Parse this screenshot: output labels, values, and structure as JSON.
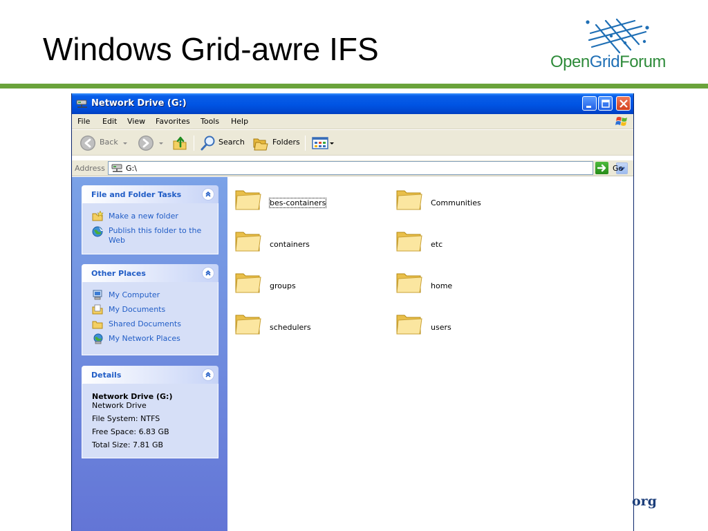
{
  "slide": {
    "title": "Windows Grid-awre IFS",
    "logo": {
      "open": "Open",
      "grid": "Grid",
      "forum": "Forum"
    },
    "org_text": "org"
  },
  "window": {
    "title": "Network Drive (G:)",
    "menu": [
      "File",
      "Edit",
      "View",
      "Favorites",
      "Tools",
      "Help"
    ],
    "toolbar": {
      "back": "Back",
      "search": "Search",
      "folders": "Folders"
    },
    "address": {
      "label": "Address",
      "value": "G:\\",
      "go": "Go"
    }
  },
  "left_pane": {
    "file_tasks": {
      "title": "File and Folder Tasks",
      "items": [
        {
          "label": "Make a new folder",
          "icon": "new-folder-icon"
        },
        {
          "label": "Publish this folder to the",
          "label2": "Web",
          "icon": "publish-web-icon"
        }
      ]
    },
    "other_places": {
      "title": "Other Places",
      "items": [
        {
          "label": "My Computer",
          "icon": "my-computer-icon"
        },
        {
          "label": "My Documents",
          "icon": "my-documents-icon"
        },
        {
          "label": "Shared Documents",
          "icon": "shared-documents-icon"
        },
        {
          "label": "My Network Places",
          "icon": "network-places-icon"
        }
      ]
    },
    "details": {
      "title": "Details",
      "name": "Network Drive (G:)",
      "type": "Network Drive",
      "file_system": "File System: NTFS",
      "free_space": "Free Space: 6.83 GB",
      "total_size": "Total Size: 7.81 GB"
    }
  },
  "folders": [
    {
      "name": "bes-containers",
      "selected": true
    },
    {
      "name": "Communities"
    },
    {
      "name": "containers"
    },
    {
      "name": "etc"
    },
    {
      "name": "groups"
    },
    {
      "name": "home"
    },
    {
      "name": "schedulers"
    },
    {
      "name": "users"
    }
  ],
  "colors": {
    "accent_green": "#6aa33b",
    "xp_blue": "#0054e3",
    "task_blue": "#215dc6",
    "org_navy": "#1c3e7a"
  }
}
